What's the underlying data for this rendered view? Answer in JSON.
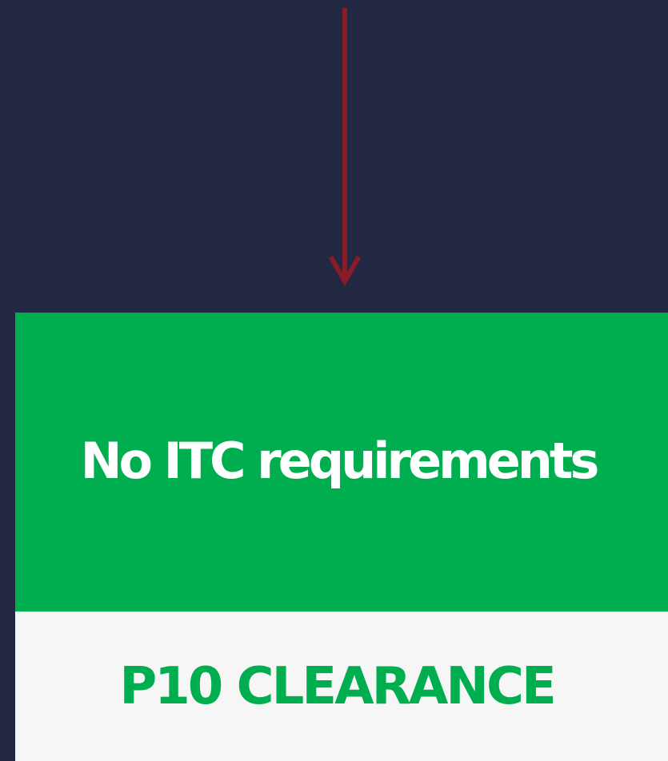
{
  "colors": {
    "background": "#222842",
    "arrow": "#8a1c27",
    "green": "#00ad4f",
    "light": "#f6f6f6",
    "white": "#ffffff"
  },
  "flow": {
    "arrow_icon": "down-arrow-icon"
  },
  "card": {
    "top_text": "No ITC requirements",
    "bottom_text": "P10 CLEARANCE"
  }
}
